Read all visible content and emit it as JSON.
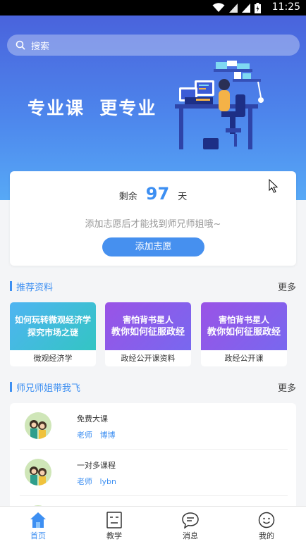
{
  "status_bar": {
    "time": "11:25"
  },
  "search": {
    "placeholder": "搜索"
  },
  "hero": {
    "slogan": "专业课  更专业"
  },
  "countdown": {
    "prefix": "剩余",
    "days": "97",
    "suffix": "天",
    "tip": "添加志愿后才能找到师兄师姐哦~",
    "button": "添加志愿"
  },
  "recommend": {
    "title": "推荐资料",
    "more": "更多",
    "items": [
      {
        "line1": "如何玩转微观经济学",
        "line2": "探究市场之谜",
        "caption": "微观经济学",
        "theme": "teal"
      },
      {
        "line1": "害怕背书星人",
        "line2": "教你如何征服政经",
        "caption": "政经公开课资料",
        "theme": "purple"
      },
      {
        "line1": "害怕背书星人",
        "line2": "教你如何征服政经",
        "caption": "政经公开课",
        "theme": "purple"
      }
    ]
  },
  "mentors": {
    "title": "师兄师姐带我飞",
    "more": "更多",
    "items": [
      {
        "name": "免费大课",
        "teacher": "老师   博博"
      },
      {
        "name": "一对多课程",
        "teacher": "老师   lybn"
      },
      {
        "name": "",
        "teacher": ""
      }
    ]
  },
  "tabs": [
    {
      "label": "首页",
      "icon": "home-icon",
      "active": true
    },
    {
      "label": "教学",
      "icon": "teaching-icon",
      "active": false
    },
    {
      "label": "消息",
      "icon": "message-icon",
      "active": false
    },
    {
      "label": "我的",
      "icon": "profile-icon",
      "active": false
    }
  ],
  "colors": {
    "primary": "#3d8ff2",
    "hero_top": "#4a63dc",
    "hero_bottom": "#57a9f6",
    "teal": "#33c5c3",
    "purple": "#8a5ee9"
  }
}
